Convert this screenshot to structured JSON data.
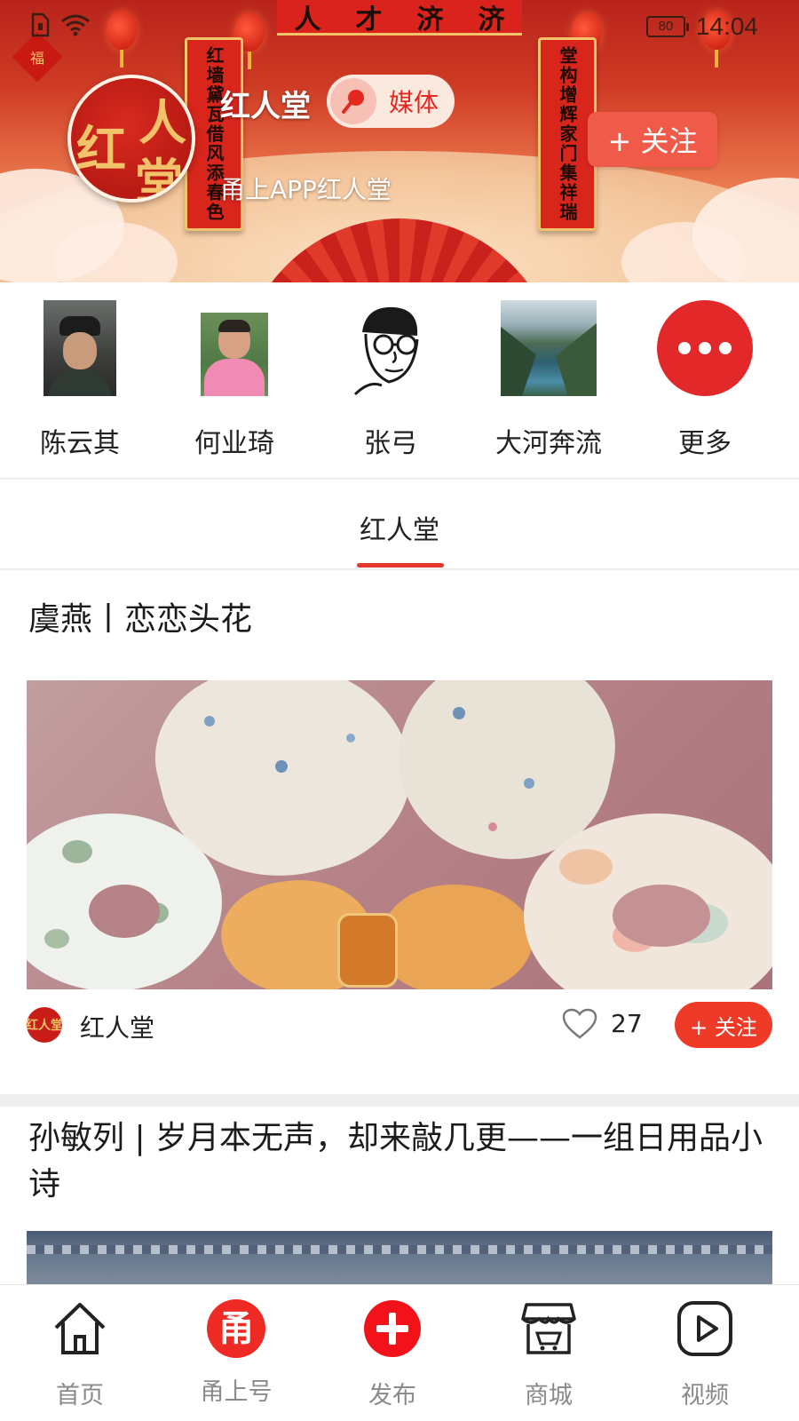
{
  "status_bar": {
    "battery": "80",
    "time": "14:04"
  },
  "banner": {
    "sign_chars": [
      "人",
      "才",
      "济",
      "济"
    ],
    "scroll_left": "红墙黛瓦借风添春色",
    "scroll_right": "堂构增辉家门集祥瑞",
    "lantern_badge": "福"
  },
  "profile": {
    "logo_chars": [
      "红",
      "人",
      "堂"
    ],
    "name": "红人堂",
    "badge": "媒体",
    "description": "甬上APP红人堂",
    "follow_label": "+ 关注"
  },
  "authors": [
    {
      "name": "陈云其"
    },
    {
      "name": "何业琦"
    },
    {
      "name": "张弓"
    },
    {
      "name": "大河奔流"
    },
    {
      "name": "更多"
    }
  ],
  "tabs": [
    {
      "label": "红人堂",
      "active": true
    }
  ],
  "articles": [
    {
      "title": "虞燕丨恋恋头花",
      "author": "红人堂",
      "likes": "27",
      "follow_label": "+ 关注"
    },
    {
      "title": "孙敏列 | 岁月本无声，却来敲几更——一组日用品小诗"
    }
  ],
  "bottom_nav": [
    {
      "label": "首页",
      "icon": "home-icon"
    },
    {
      "label": "甬上号",
      "icon": "yongshang-icon",
      "glyph": "甬"
    },
    {
      "label": "发布",
      "icon": "publish-plus-icon"
    },
    {
      "label": "商城",
      "icon": "shop-icon"
    },
    {
      "label": "视频",
      "icon": "video-play-icon"
    }
  ],
  "colors": {
    "accent": "#e6372b",
    "follow": "#ef3a28",
    "more": "#e3282a"
  }
}
